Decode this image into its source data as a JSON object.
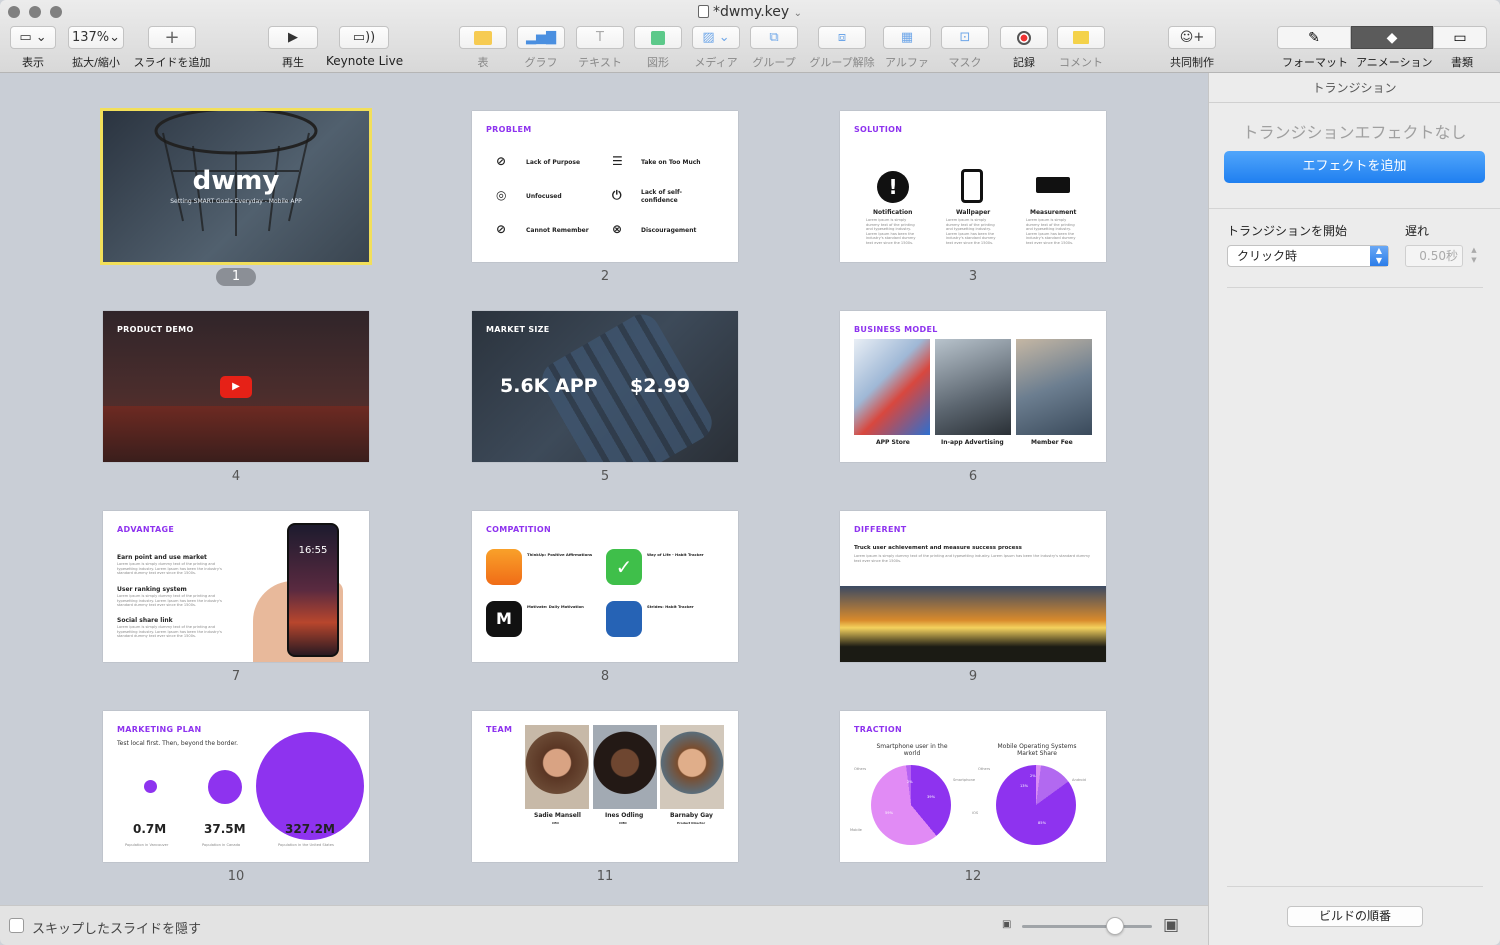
{
  "window": {
    "title": "*dwmy.key"
  },
  "toolbar": {
    "view": "表示",
    "zoom_value": "137%",
    "zoom": "拡大/縮小",
    "add_slide": "スライドを追加",
    "play": "再生",
    "keynote_live": "Keynote Live",
    "table": "表",
    "chart": "グラフ",
    "text": "テキスト",
    "shape": "図形",
    "media": "メディア",
    "group": "グループ",
    "ungroup": "グループ解除",
    "alpha": "アルファ",
    "mask": "マスク",
    "record": "記録",
    "comment": "コメント",
    "collaborate": "共同制作",
    "format": "フォーマット",
    "animate": "アニメーション",
    "document": "書類"
  },
  "colors": {
    "accent": "#8e33ef",
    "blue": "#2f8ff0",
    "selection": "#f2df5a"
  },
  "slides": {
    "s1": {
      "num": "1",
      "title": "dwmy",
      "subtitle": "Setting SMART Goals Everyday - Mobile APP"
    },
    "s2": {
      "num": "2",
      "title": "PROBLEM",
      "items": [
        "Lack of Purpose",
        "Take on Too Much",
        "Unfocused",
        "Lack of self-confidence",
        "Cannot Remember",
        "Discouragement"
      ]
    },
    "s3": {
      "num": "3",
      "title": "SOLUTION",
      "items": [
        "Notification",
        "Wallpaper",
        "Measurement"
      ]
    },
    "s4": {
      "num": "4",
      "title": "PRODUCT DEMO"
    },
    "s5": {
      "num": "5",
      "title": "MARKET SIZE",
      "v1": "5.6K APP",
      "v2": "$2.99"
    },
    "s6": {
      "num": "6",
      "title": "BUSINESS MODEL",
      "items": [
        "APP Store",
        "In-app Advertising",
        "Member Fee"
      ]
    },
    "s7": {
      "num": "7",
      "title": "ADVANTAGE",
      "items": [
        "Earn point and use market",
        "User ranking system",
        "Social share link"
      ],
      "time": "16:55"
    },
    "s8": {
      "num": "8",
      "title": "COMPATITION",
      "apps": [
        "ThinkUp: Positive Affirmations",
        "Way of Life - Habit Tracker",
        "Motivate: Daily Motivation",
        "Strides: Habit Tracker"
      ]
    },
    "s9": {
      "num": "9",
      "title": "DIFFERENT",
      "heading": "Truck user achievement and measure success process"
    },
    "s10": {
      "num": "10",
      "title": "MARKETING PLAN",
      "sub": "Test local first. Then, beyond the border.",
      "values": [
        "0.7M",
        "37.5M",
        "327.2M"
      ],
      "captions": [
        "Population in Vancouver",
        "Population in Canada",
        "Population in the United States"
      ]
    },
    "s11": {
      "num": "11",
      "title": "TEAM",
      "members": [
        "Sadie Mansell",
        "Ines Odling",
        "Barnaby Gay"
      ],
      "roles": [
        "CEO",
        "CMO",
        "Product Director"
      ]
    },
    "s12": {
      "num": "12",
      "title": "TRACTION",
      "c1": "Smartphone user in the world",
      "c2": "Mobile Operating Systems Market Share",
      "p1": [
        "2%",
        "39%",
        "59%"
      ],
      "p2": [
        "2%",
        "13%",
        "85%"
      ],
      "l1": [
        "Others",
        "Smartphone",
        "Mobile"
      ],
      "l2": [
        "Others",
        "Android",
        "iOS"
      ]
    }
  },
  "lorem": "Lorem ipsum is simply dummy text of the printing and typesetting industry. Lorem Ipsum has been the industry's standard dummy text ever since the 1500s.",
  "bottom": {
    "hide_skipped": "スキップしたスライドを隠す"
  },
  "inspector": {
    "header": "トランジション",
    "none": "トランジションエフェクトなし",
    "add_effect": "エフェクトを追加",
    "start_label": "トランジションを開始",
    "start_value": "クリック時",
    "delay_label": "遅れ",
    "delay_value": "0.50秒",
    "build_order": "ビルドの順番"
  }
}
